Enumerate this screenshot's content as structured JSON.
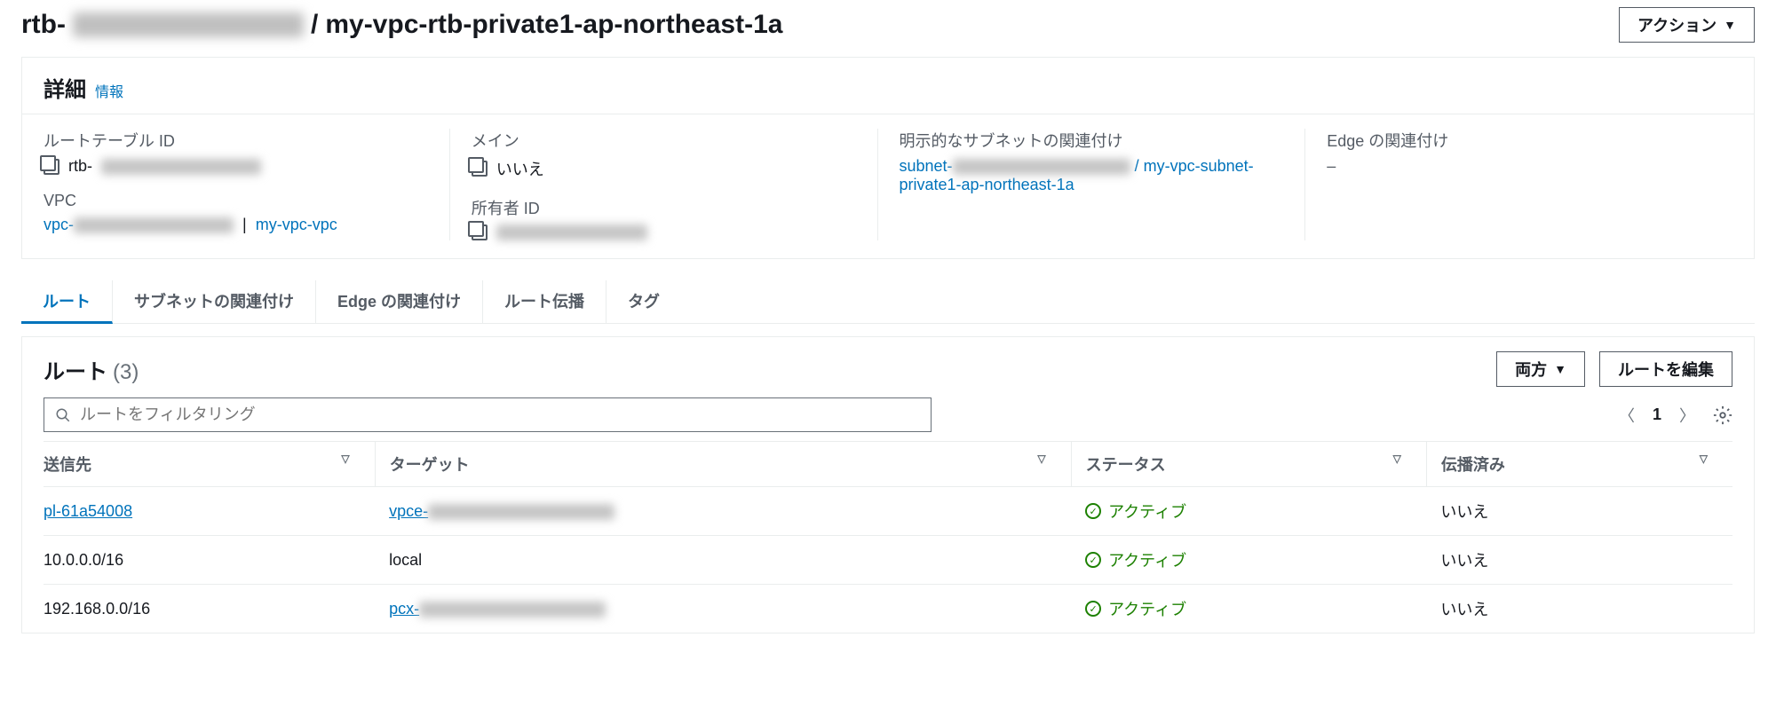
{
  "header": {
    "rtb_prefix": "rtb-",
    "separator": " / ",
    "rtb_name": "my-vpc-rtb-private1-ap-northeast-1a",
    "actions_label": "アクション"
  },
  "details": {
    "title": "詳細",
    "info_label": "情報",
    "route_table_id": {
      "label": "ルートテーブル ID",
      "value_prefix": "rtb-"
    },
    "vpc": {
      "label": "VPC",
      "link_prefix": "vpc-",
      "sep": " | ",
      "name": "my-vpc-vpc"
    },
    "main": {
      "label": "メイン",
      "value": "いいえ"
    },
    "owner": {
      "label": "所有者 ID"
    },
    "subnet_assoc": {
      "label": "明示的なサブネットの関連付け",
      "link_prefix": "subnet-",
      "sep": " / ",
      "name": "my-vpc-subnet-private1-ap-northeast-1a"
    },
    "edge_assoc": {
      "label": "Edge の関連付け",
      "value": "–"
    }
  },
  "tabs": [
    {
      "label": "ルート",
      "active": true
    },
    {
      "label": "サブネットの関連付け",
      "active": false
    },
    {
      "label": "Edge の関連付け",
      "active": false
    },
    {
      "label": "ルート伝播",
      "active": false
    },
    {
      "label": "タグ",
      "active": false
    }
  ],
  "routes": {
    "title": "ルート",
    "count": "(3)",
    "filter_placeholder": "ルートをフィルタリング",
    "view_mode": "両方",
    "edit_label": "ルートを編集",
    "page": "1",
    "columns": {
      "dest": "送信先",
      "target": "ターゲット",
      "status": "ステータス",
      "propagated": "伝播済み"
    },
    "rows": [
      {
        "dest": "pl-61a54008",
        "dest_link": true,
        "target_prefix": "vpce-",
        "target_blur": true,
        "target_link": true,
        "status": "アクティブ",
        "propagated": "いいえ"
      },
      {
        "dest": "10.0.0.0/16",
        "dest_link": false,
        "target": "local",
        "target_link": false,
        "status": "アクティブ",
        "propagated": "いいえ"
      },
      {
        "dest": "192.168.0.0/16",
        "dest_link": false,
        "target_prefix": "pcx-",
        "target_blur": true,
        "target_link": true,
        "status": "アクティブ",
        "propagated": "いいえ"
      }
    ]
  }
}
